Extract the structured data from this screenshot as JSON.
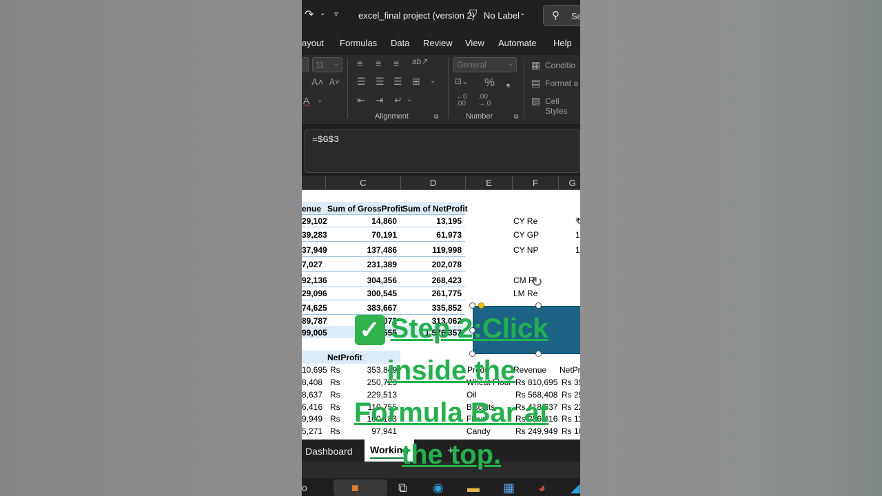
{
  "titlebar": {
    "title": "excel_final project (version 2)",
    "label": "No Label",
    "search_text": "Se"
  },
  "tabs": [
    "ayout",
    "Formulas",
    "Data",
    "Review",
    "View",
    "Automate",
    "Help"
  ],
  "ribbon": {
    "font_size": "11",
    "number_format": "General",
    "alignment_group": "Alignment",
    "number_group": "Number",
    "styles": [
      "Conditio",
      "Format a",
      "Cell Styles"
    ]
  },
  "formula_bar": {
    "formula": "=$G$3"
  },
  "columns": [
    "C",
    "D",
    "E",
    "F",
    "G"
  ],
  "pivot": {
    "headers": [
      "enue",
      "Sum of GrossProfit",
      "Sum of NetProfit"
    ],
    "rows": [
      [
        "29,102",
        "14,860",
        "13,195"
      ],
      [
        "39,283",
        "70,191",
        "61,973"
      ],
      [
        "37,949",
        "137,486",
        "119,998"
      ],
      [
        "7,027",
        "231,389",
        "202,078"
      ],
      [
        "92,136",
        "304,356",
        "268,423"
      ],
      [
        "29,096",
        "300,545",
        "261,775"
      ],
      [
        "74,625",
        "383,667",
        "335,852"
      ],
      [
        "89,787",
        "353,072",
        "313,062"
      ]
    ],
    "total": [
      "99,005",
      "1,797,555",
      "1,576,357"
    ]
  },
  "kpi_labels": [
    "CY Re",
    "CY GP",
    "CY NP",
    "CM R",
    "LM Re"
  ],
  "kpi_values": [
    "₹",
    "1",
    "1"
  ],
  "table2": {
    "header": "NetProfit",
    "rows": [
      [
        "10,695",
        "Rs",
        "353,849"
      ],
      [
        "8,408",
        "Rs",
        "250,723"
      ],
      [
        "8,637",
        "Rs",
        "229,513"
      ],
      [
        "6,416",
        "Rs",
        "110,755"
      ],
      [
        "9,949",
        "Rs",
        "100,183"
      ],
      [
        "5,271",
        "Rs",
        "97,941"
      ]
    ]
  },
  "table3": {
    "headers": [
      "Produ",
      "Revenue",
      "NetPr"
    ],
    "rows": [
      [
        "Wheat Flour",
        "Rs 810,695",
        "Rs 35"
      ],
      [
        "Oil",
        "Rs 568,408",
        "Rs 25"
      ],
      [
        "Biscuits",
        "Rs 418,637",
        "Rs 22"
      ],
      [
        "Flour",
        "Rs 256,416",
        "Rs 11"
      ],
      [
        "Candy",
        "Rs 249,949",
        "Rs 10"
      ]
    ]
  },
  "sheet_tabs": [
    "Dashboard",
    "Working"
  ],
  "overlay": {
    "line1": "Step 2:Click",
    "line2": "inside the",
    "line3": "Formula Bar at",
    "line4": "the top."
  }
}
